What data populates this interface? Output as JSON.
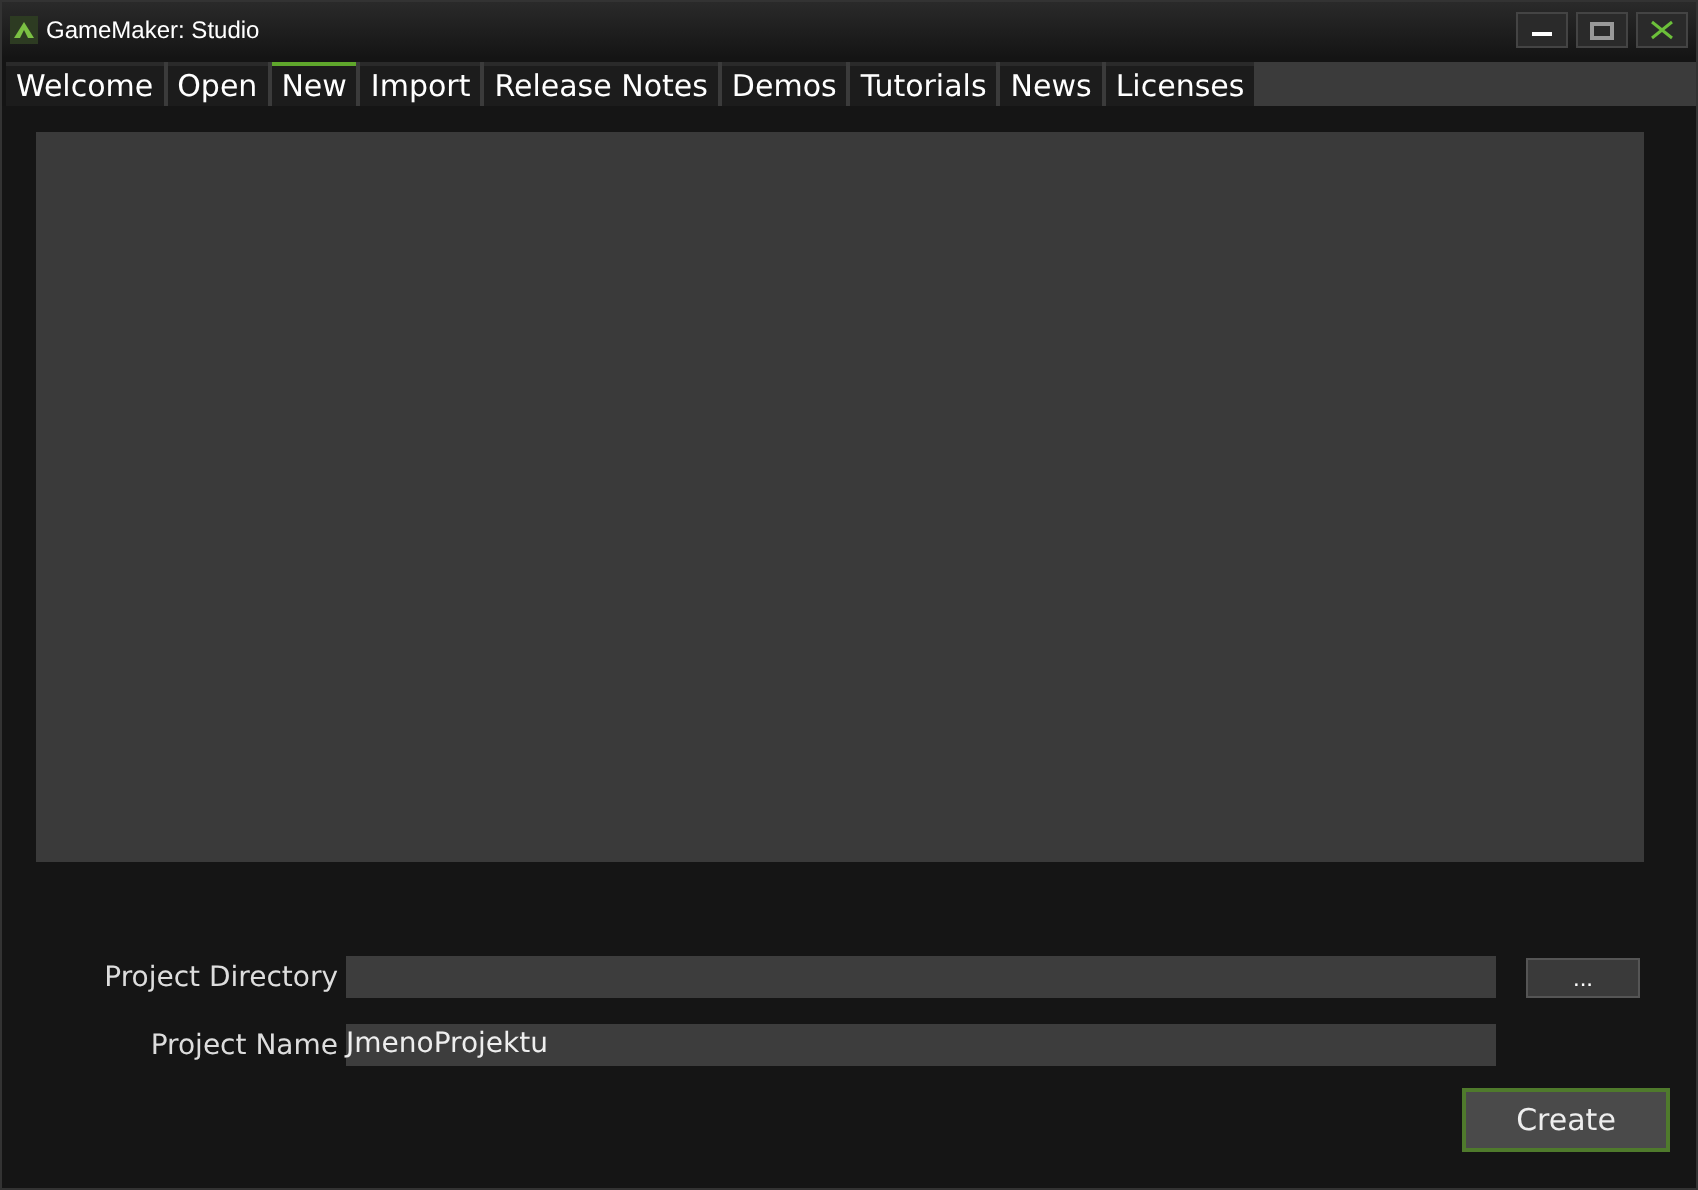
{
  "window": {
    "title": "GameMaker: Studio"
  },
  "tabs": [
    {
      "label": "Welcome",
      "selected": false
    },
    {
      "label": "Open",
      "selected": false
    },
    {
      "label": "New",
      "selected": true
    },
    {
      "label": "Import",
      "selected": false
    },
    {
      "label": "Release Notes",
      "selected": false
    },
    {
      "label": "Demos",
      "selected": false
    },
    {
      "label": "Tutorials",
      "selected": false
    },
    {
      "label": "News",
      "selected": false
    },
    {
      "label": "Licenses",
      "selected": false
    }
  ],
  "form": {
    "directory_label": "Project Directory",
    "browse_button": "...",
    "name_label": "Project Name",
    "name_value": "JmenoProjektu",
    "create_button": "Create"
  }
}
